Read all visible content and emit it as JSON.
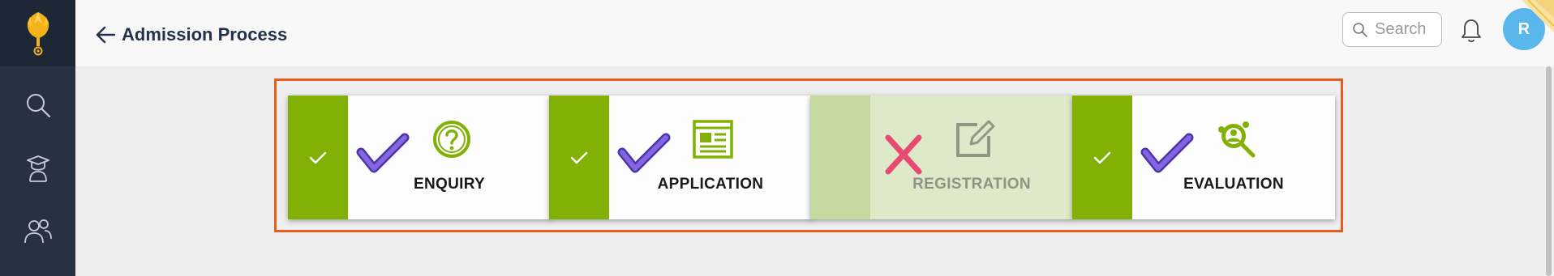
{
  "header": {
    "title": "Admission Process",
    "search_placeholder": "Search",
    "avatar_initial": "R"
  },
  "sidebar": {
    "items": [
      {
        "icon": "search-icon"
      },
      {
        "icon": "graduate-icon"
      },
      {
        "icon": "people-icon"
      }
    ]
  },
  "steps": [
    {
      "label": "ENQUIRY",
      "status": "completed",
      "icon": "question-icon"
    },
    {
      "label": "APPLICATION",
      "status": "completed",
      "icon": "form-icon"
    },
    {
      "label": "REGISTRATION",
      "status": "not-completed",
      "icon": "edit-icon"
    },
    {
      "label": "EVALUATION",
      "status": "completed",
      "icon": "evaluation-search-icon"
    }
  ],
  "colors": {
    "sidebar": "#273142",
    "accent_green": "#82b005",
    "check_purple": "#6a4fc4",
    "cross_pink": "#e94a72",
    "highlight_frame": "#eb5b1b",
    "avatar": "#5ab7ec"
  }
}
